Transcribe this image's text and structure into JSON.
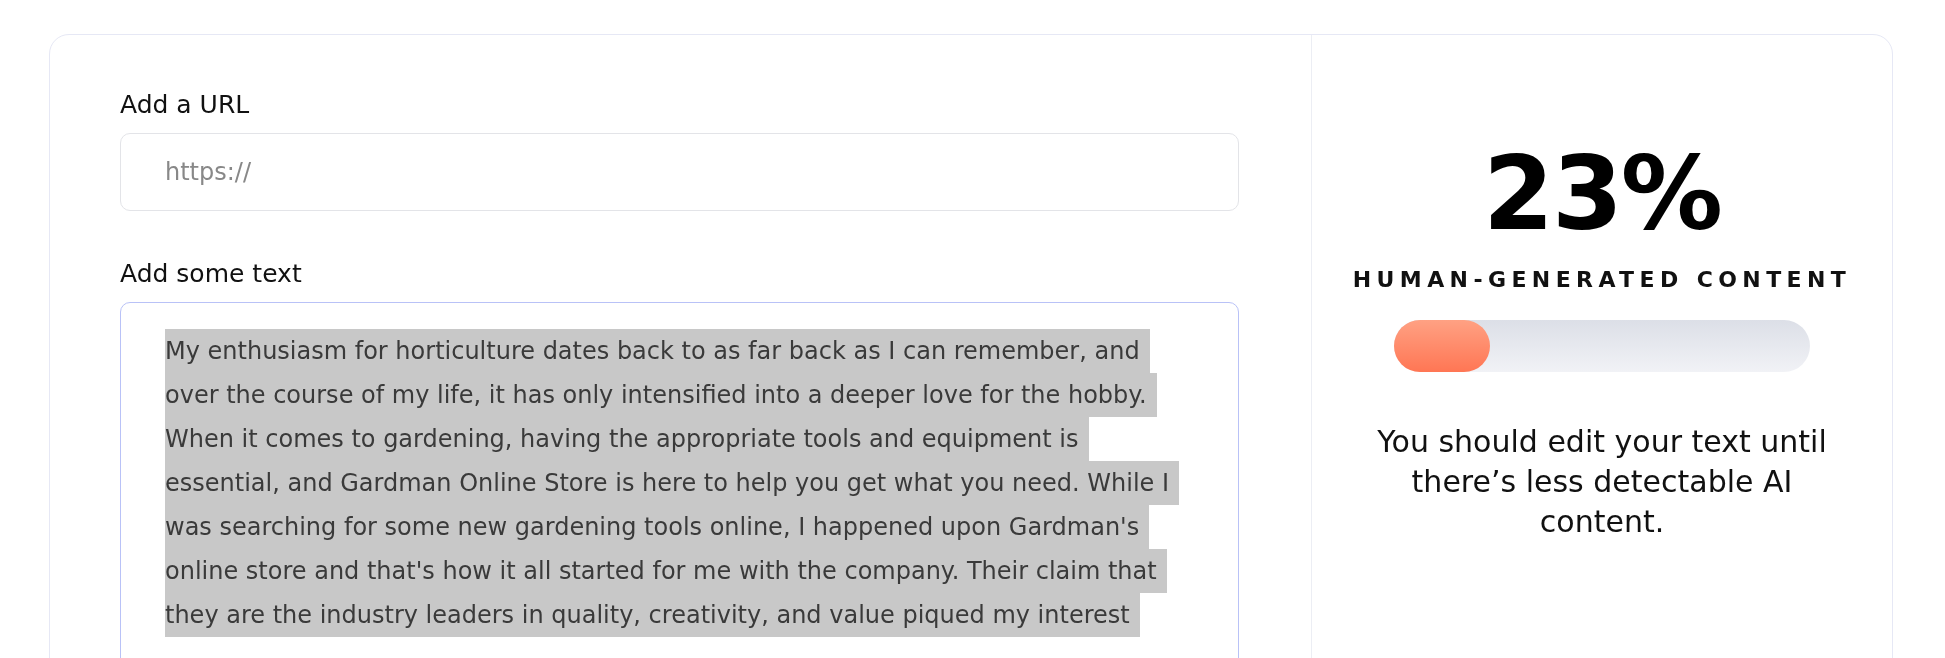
{
  "url_field": {
    "label": "Add a URL",
    "placeholder": "https://"
  },
  "text_field": {
    "label": "Add some text",
    "selected": true,
    "lines": [
      "My enthusiasm for horticulture dates back to as far back as I can remember, and",
      "over the course of my life, it has only intensified into a deeper love for the hobby.",
      "When it comes to gardening, having the appropriate tools and equipment is",
      "essential, and Gardman Online Store is here to help you get what you need. While I",
      "was searching for some new gardening tools online, I happened upon Gardman's",
      "online store and that's how it all started for me with the company. Their claim that",
      "they are the industry leaders in quality, creativity, and value piqued my interest"
    ]
  },
  "result": {
    "score": "23%",
    "caption": "HUMAN-GENERATED CONTENT",
    "level": 0.23,
    "message": "You should edit your text until there’s less detectable AI content."
  }
}
